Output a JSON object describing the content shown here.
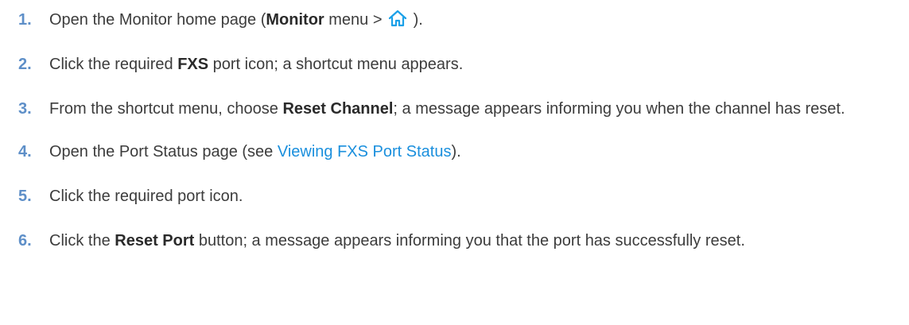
{
  "steps": [
    {
      "number": "1.",
      "t1": "Open the Monitor home page (",
      "b1": "Monitor",
      "t2": " menu > ",
      "t3": " )."
    },
    {
      "number": "2.",
      "t1": "Click the required ",
      "b1": "FXS",
      "t2": " port icon; a shortcut menu appears."
    },
    {
      "number": "3.",
      "t1": "From the shortcut menu, choose ",
      "b1": "Reset Channel",
      "t2": "; a message appears informing you when the channel has reset."
    },
    {
      "number": "4.",
      "t1": "Open the Port Status page (see ",
      "link": "Viewing FXS Port Status",
      "t2": ")."
    },
    {
      "number": "5.",
      "t1": "Click the required port icon."
    },
    {
      "number": "6.",
      "t1": "Click the ",
      "b1": "Reset Port",
      "t2": " button; a message appears informing you that the port has successfully reset."
    }
  ],
  "icons": {
    "home": "home-icon"
  },
  "colors": {
    "step_number": "#5e8fc8",
    "link": "#1a8fdd",
    "home_icon": "#1aa0e8"
  }
}
